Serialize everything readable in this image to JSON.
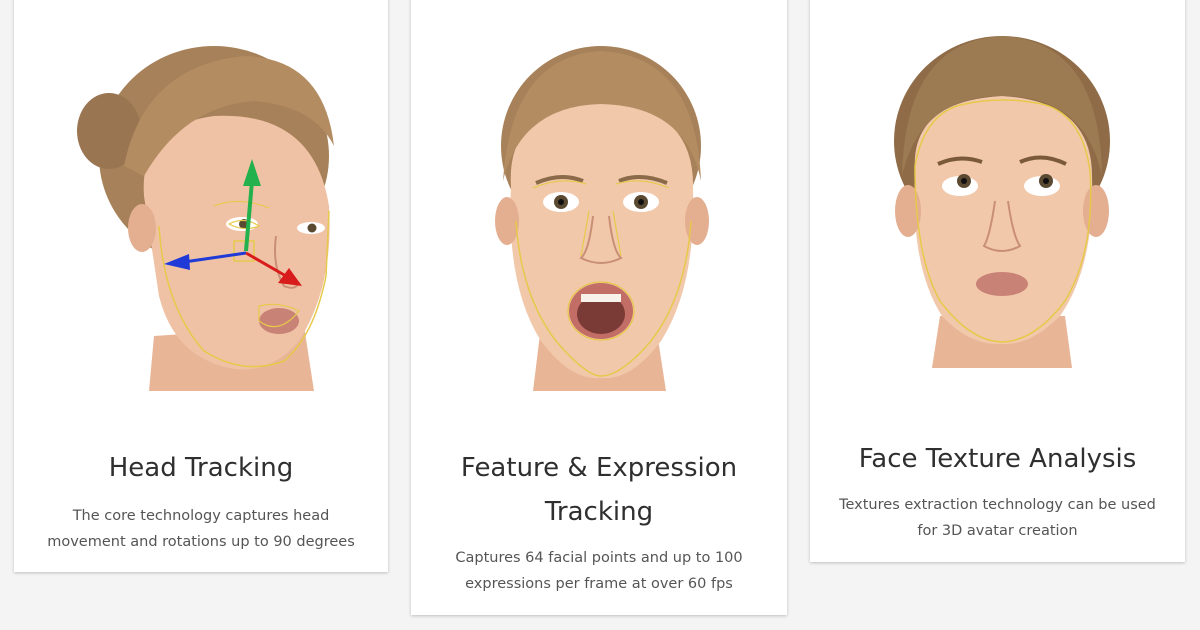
{
  "cards": [
    {
      "title": "Head Tracking",
      "description": "The core technology captures head movement and rotations up to 90 degrees"
    },
    {
      "title": "Feature & Expression Tracking",
      "description": "Captures 64 facial points and up to 100 expressions per frame at over 60 fps"
    },
    {
      "title": "Face Texture Analysis",
      "description": "Textures extraction technology can be used for 3D avatar creation"
    }
  ],
  "colors": {
    "page_background": "#f4f4f4",
    "card_background": "#ffffff",
    "title_text": "#2f2f2f",
    "body_text": "#555555",
    "tracking_outline": "#e6c94a",
    "axis_y": "#22b14c",
    "axis_x": "#1f3ad6",
    "axis_z": "#d81b1b"
  },
  "icons": [
    "head-tracking-portrait",
    "expression-tracking-portrait",
    "face-texture-portrait",
    "3d-axis-gizmo-icon"
  ]
}
